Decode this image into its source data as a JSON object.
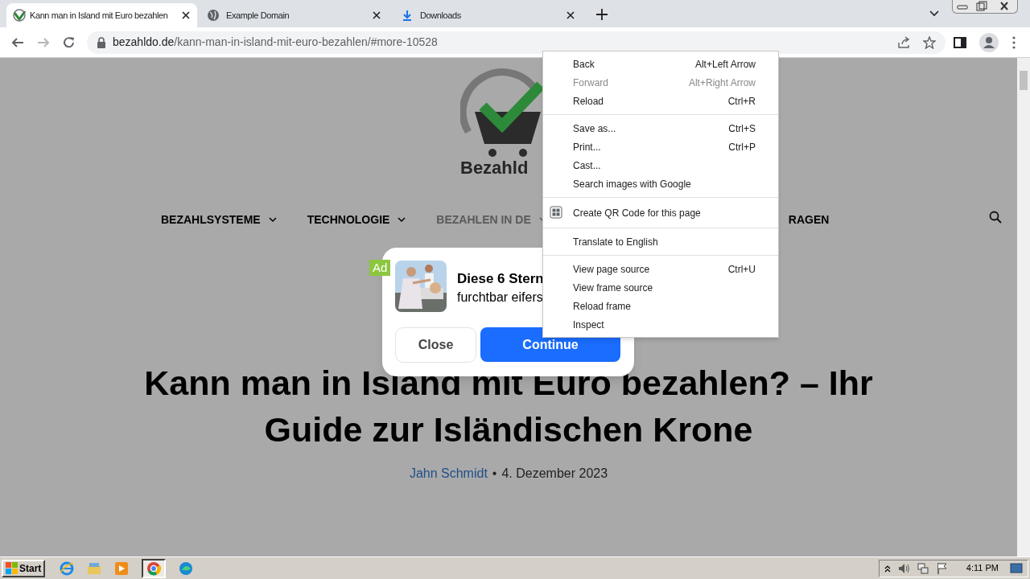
{
  "tabs": [
    {
      "title": "Kann man in Island mit Euro bezahlen",
      "kind": "site",
      "selected": true
    },
    {
      "title": "Example Domain",
      "kind": "globe",
      "selected": false
    },
    {
      "title": "Downloads",
      "kind": "download",
      "selected": false
    }
  ],
  "toolbar": {
    "back_disabled": false,
    "forward_disabled": true,
    "address_host": "bezahldo.de",
    "address_path": "/kann-man-in-island-mit-euro-bezahlen/#more-10528"
  },
  "page": {
    "logo_text": "Bezahld",
    "nav": [
      {
        "label": "BEZAHLSYSTEME",
        "has_submenu": true,
        "selected": false
      },
      {
        "label": "TECHNOLOGIE",
        "has_submenu": true,
        "selected": false
      },
      {
        "label": "BEZAHLEN IN DE",
        "has_submenu": true,
        "selected": true
      },
      {
        "label": "RAGEN",
        "has_submenu": false,
        "selected": false
      }
    ],
    "headline": "Kann man in Island mit Euro bezahlen? – Ihr Guide zur Isländischen Krone",
    "author": "Jahn Schmidt",
    "separator": "•",
    "date": "4. Dezember 2023"
  },
  "ad": {
    "badge": "Ad",
    "title": "Diese 6 Stern",
    "text": "furchtbar eifers",
    "buttons": [
      {
        "label": "Close",
        "kind": "secondary"
      },
      {
        "label": "Continue",
        "kind": "primary"
      }
    ]
  },
  "context_menu": {
    "groups": [
      [
        {
          "label": "Back",
          "shortcut": "Alt+Left Arrow",
          "disabled": false,
          "kind": "plain"
        },
        {
          "label": "Forward",
          "shortcut": "Alt+Right Arrow",
          "disabled": true,
          "kind": "plain"
        },
        {
          "label": "Reload",
          "shortcut": "Ctrl+R",
          "disabled": false,
          "kind": "plain"
        }
      ],
      [
        {
          "label": "Save as...",
          "shortcut": "Ctrl+S",
          "disabled": false,
          "kind": "plain"
        },
        {
          "label": "Print...",
          "shortcut": "Ctrl+P",
          "disabled": false,
          "kind": "plain"
        },
        {
          "label": "Cast...",
          "disabled": false,
          "kind": "plain"
        },
        {
          "label": "Search images with Google",
          "disabled": false,
          "kind": "plain"
        }
      ],
      [
        {
          "label": "Create QR Code for this page",
          "disabled": false,
          "kind": "qr"
        }
      ],
      [
        {
          "label": "Translate to English",
          "disabled": false,
          "kind": "plain"
        }
      ],
      [
        {
          "label": "View page source",
          "shortcut": "Ctrl+U",
          "disabled": false,
          "kind": "plain"
        },
        {
          "label": "View frame source",
          "disabled": false,
          "kind": "plain"
        },
        {
          "label": "Reload frame",
          "disabled": false,
          "kind": "plain"
        },
        {
          "label": "Inspect",
          "disabled": false,
          "kind": "plain"
        }
      ]
    ]
  },
  "taskbar": {
    "start": "Start",
    "clock": "4:11 PM"
  }
}
